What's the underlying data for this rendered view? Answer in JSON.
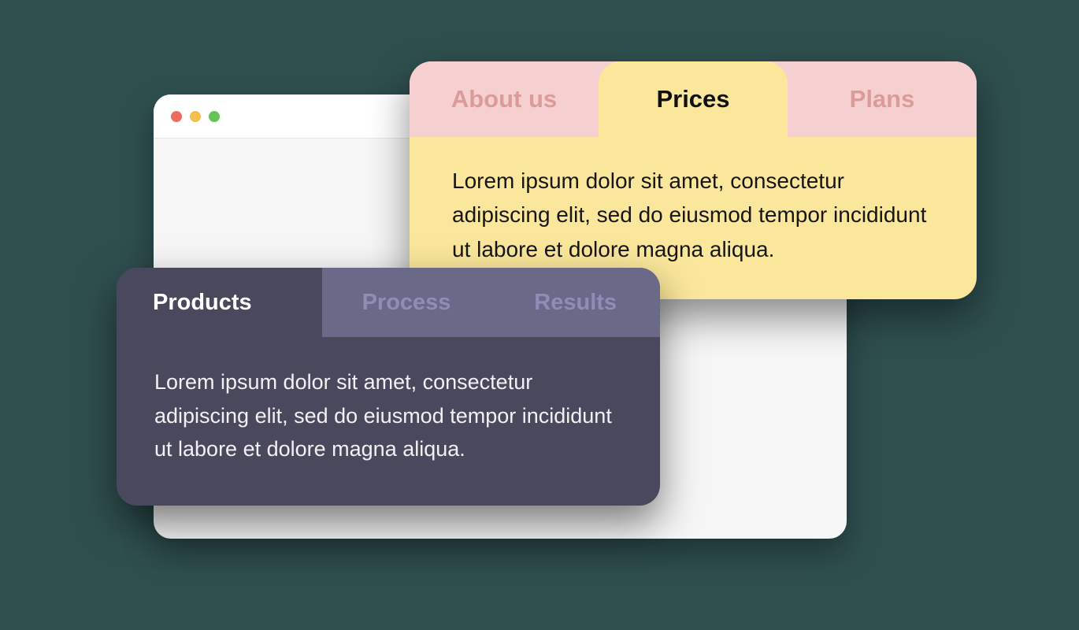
{
  "browser": {
    "traffic_lights": [
      "close",
      "minimize",
      "zoom"
    ]
  },
  "light_card": {
    "tabs": [
      {
        "label": "About us",
        "active": false
      },
      {
        "label": "Prices",
        "active": true
      },
      {
        "label": "Plans",
        "active": false
      }
    ],
    "content": "Lorem ipsum dolor sit amet, consectetur adipiscing elit, sed do eiusmod tempor incididunt ut labore et dolore magna aliqua."
  },
  "dark_card": {
    "tabs": [
      {
        "label": "Products",
        "active": true
      },
      {
        "label": "Process",
        "active": false
      },
      {
        "label": "Results",
        "active": false
      }
    ],
    "content": "Lorem ipsum dolor sit amet, consectetur adipiscing elit, sed do eiusmod tempor incididunt ut labore et dolore magna aliqua."
  },
  "colors": {
    "page_bg": "#2f4f4f",
    "light_tab_bg": "#f6d0d0",
    "light_tab_active_bg": "#fbe79b",
    "light_tab_inactive_text": "#db9b98",
    "dark_card_bg": "#4a485d",
    "dark_tab_inactive_bg": "#6a6988",
    "dark_tab_inactive_text": "#8f8db7"
  }
}
